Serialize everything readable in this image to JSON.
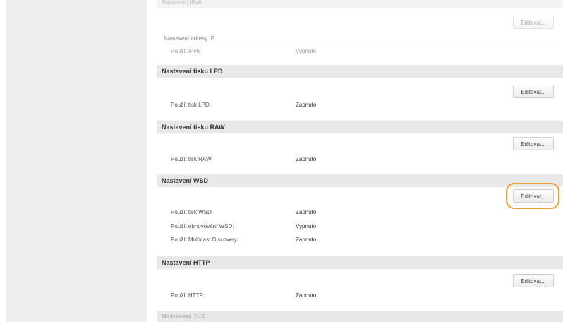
{
  "top_partial_header": "Nastavení IPv6",
  "edit_label": "Editovat...",
  "ip_section": {
    "subheading": "Nastavení adresy IP",
    "rows": [
      {
        "label": "Použít IPv6:",
        "value": "Vypnuto"
      }
    ]
  },
  "lpd": {
    "title": "Nastavení tisku LPD",
    "rows": [
      {
        "label": "Použít tisk LPD:",
        "value": "Zapnuto"
      }
    ]
  },
  "raw": {
    "title": "Nastavení tisku RAW",
    "rows": [
      {
        "label": "Použít tisk RAW:",
        "value": "Zapnuto"
      }
    ]
  },
  "wsd": {
    "title": "Nastavení WSD",
    "rows": [
      {
        "label": "Použít tisk WSD:",
        "value": "Zapnuto"
      },
      {
        "label": "Použít obnovování WSD:",
        "value": "Vypnuto"
      },
      {
        "label": "Použít Multicast Discovery:",
        "value": "Zapnuto"
      }
    ]
  },
  "http": {
    "title": "Nastavení HTTP",
    "rows": [
      {
        "label": "Použít HTTP:",
        "value": "Zapnuto"
      }
    ]
  },
  "tls": {
    "title": "Nastavení TLS"
  },
  "highlight_color": "#f0a030"
}
